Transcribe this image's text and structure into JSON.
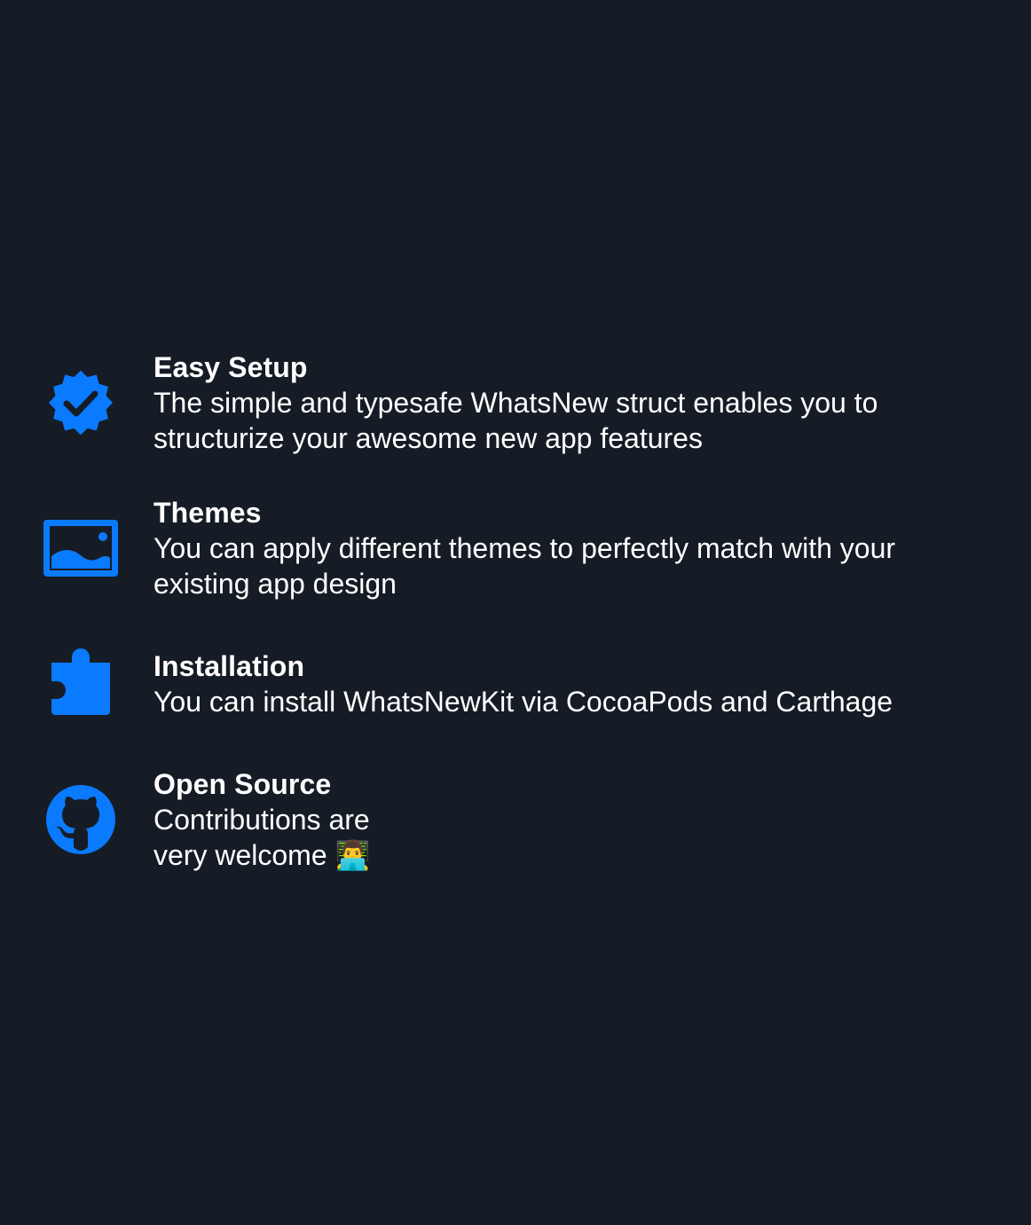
{
  "colors": {
    "background": "#161c25",
    "accent": "#0a7aff",
    "text": "#ffffff"
  },
  "features": [
    {
      "icon": "checkmark-seal-icon",
      "title": "Easy Setup",
      "subtitle": "The simple and typesafe WhatsNew struct enables you to\nstructurize your awesome new app features"
    },
    {
      "icon": "photo-icon",
      "title": "Themes",
      "subtitle": "You can apply different themes to perfectly match with your\nexisting app design"
    },
    {
      "icon": "puzzle-piece-icon",
      "title": "Installation",
      "subtitle": "You can install WhatsNewKit via CocoaPods and Carthage"
    },
    {
      "icon": "github-icon",
      "title": "Open Source",
      "subtitle": "Contributions are\nvery welcome 👨‍💻"
    }
  ]
}
